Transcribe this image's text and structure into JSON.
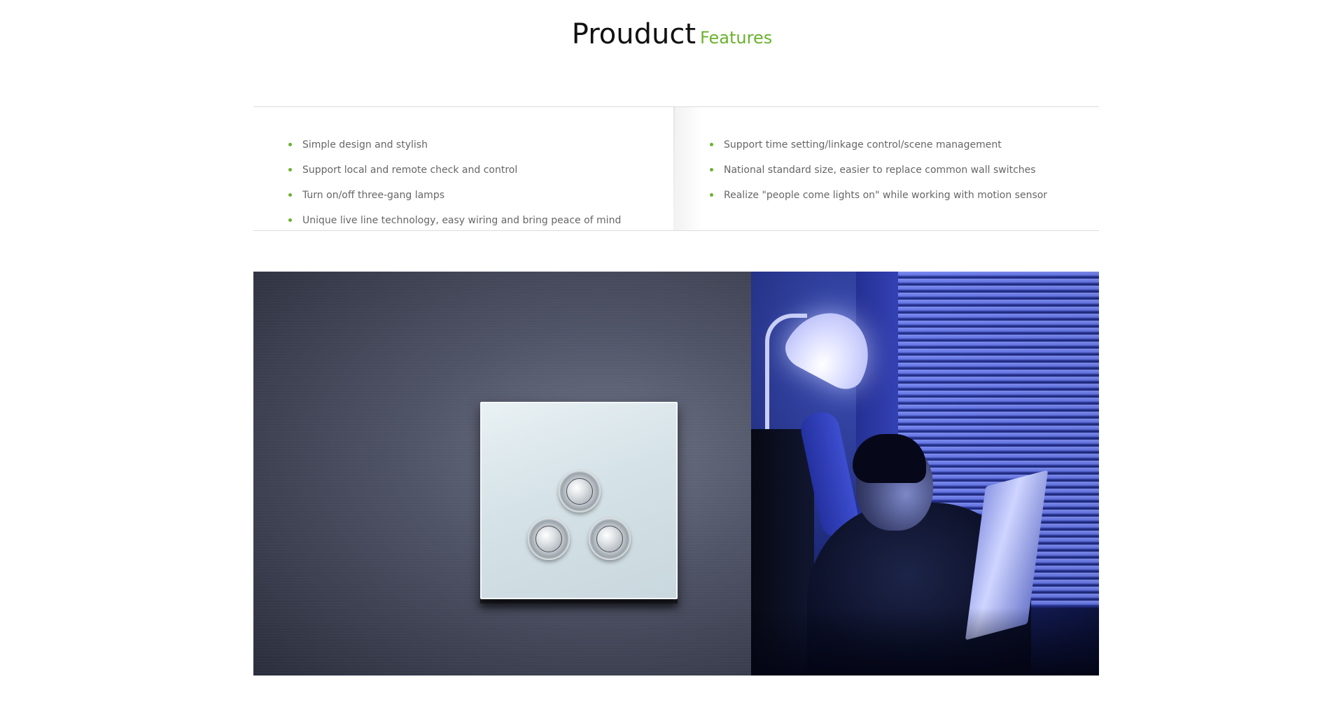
{
  "heading": {
    "main": "Prouduct",
    "sub": "Features"
  },
  "features": {
    "left": [
      "Simple design and stylish",
      "Support local and remote check and control",
      "Turn on/off three-gang lamps",
      "Unique live line technology, easy wiring and bring peace of mind"
    ],
    "right": [
      "Support time setting/linkage control/scene management",
      "National standard size, easier to replace common wall switches",
      "Realize \"people come lights on\" while working with motion sensor"
    ]
  },
  "colors": {
    "accent": "#6bb22e",
    "text": "#666666",
    "heading": "#111111"
  },
  "icons": {
    "bullet": "green-dot-icon"
  }
}
